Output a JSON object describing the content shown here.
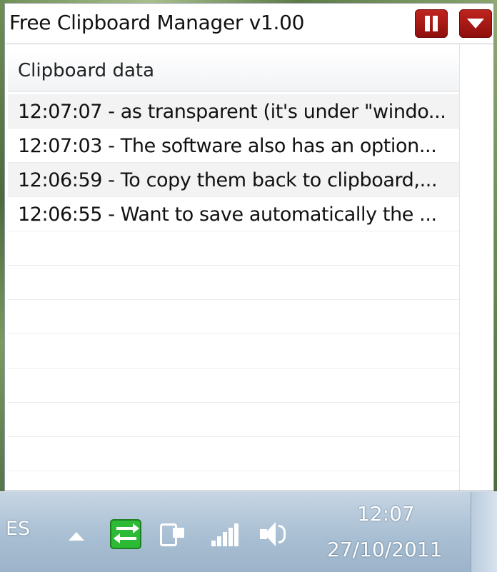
{
  "window": {
    "title": "Free Clipboard Manager v1.00"
  },
  "grid": {
    "column_header": "Clipboard data",
    "rows": [
      "12:07:07 - as transparent (it's under \"windo...",
      "12:07:03 - The software also has an option...",
      "12:06:59 - To copy them back to clipboard,...",
      "12:06:55 - Want to save automatically the ..."
    ]
  },
  "taskbar": {
    "language": "ES",
    "time": "12:07",
    "date": "27/10/2011",
    "icons": [
      "show-hidden-icons-arrow-icon",
      "clipboard-manager-icon",
      "power-icon",
      "network-signal-icon",
      "volume-icon"
    ]
  }
}
